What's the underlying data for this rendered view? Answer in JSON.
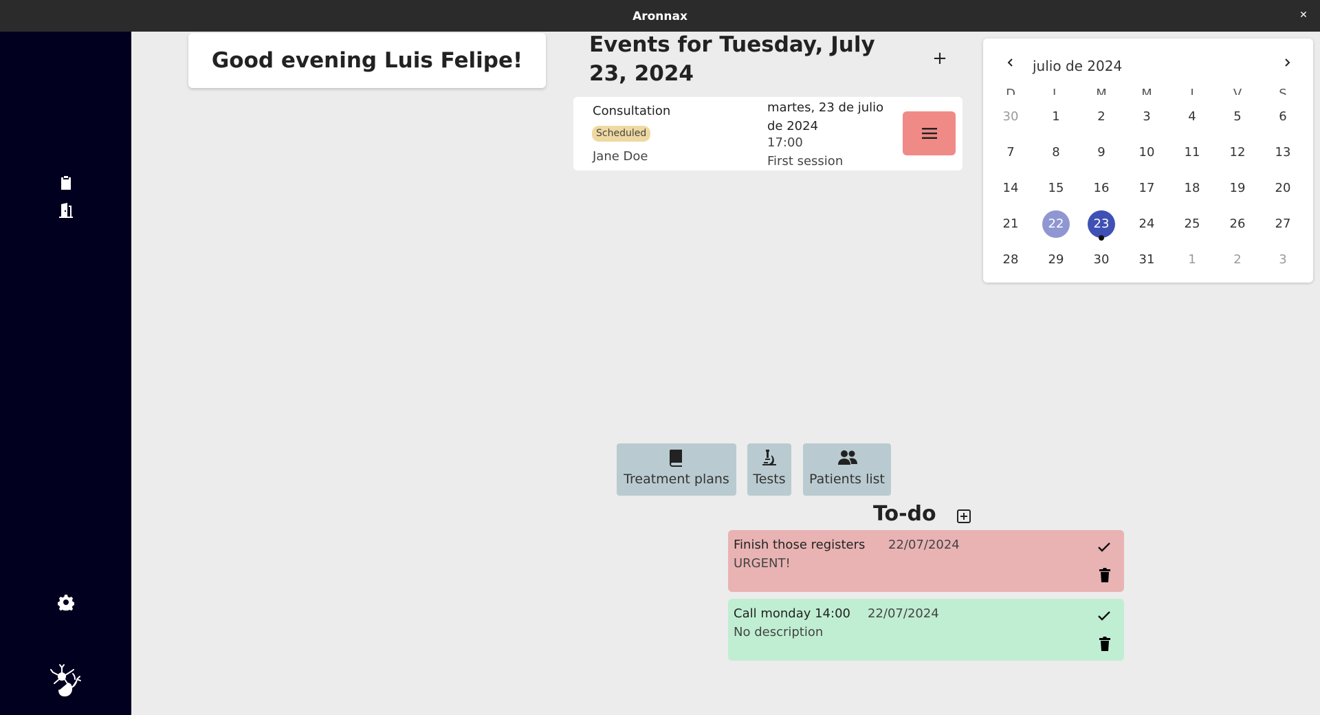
{
  "window": {
    "title": "Aronnax",
    "close_icon": "close-icon"
  },
  "sidebar": {
    "icons": [
      "clipboard-badge-icon",
      "door-exit-icon",
      "gear-icon",
      "app-logo"
    ]
  },
  "greeting": {
    "text": "Good evening Luis Felipe!"
  },
  "events": {
    "title": "Events for Tuesday, July 23, 2024",
    "add_label": "+",
    "items": [
      {
        "type": "Consultation",
        "status": "Scheduled",
        "status_color": "#efd9a1",
        "patient": "Jane Doe",
        "date": "martes, 23 de julio de 2024",
        "time": "17:00",
        "description": "First session",
        "menu_color": "#f08a87"
      }
    ]
  },
  "calendar": {
    "month_label": "julio de 2024",
    "weekdays": [
      "D",
      "L",
      "M",
      "M",
      "J",
      "V",
      "S"
    ],
    "weeks": [
      [
        "30",
        "1",
        "2",
        "3",
        "4",
        "5",
        "6"
      ],
      [
        "7",
        "8",
        "9",
        "10",
        "11",
        "12",
        "13"
      ],
      [
        "14",
        "15",
        "16",
        "17",
        "18",
        "19",
        "20"
      ],
      [
        "21",
        "22",
        "23",
        "24",
        "25",
        "26",
        "27"
      ],
      [
        "28",
        "29",
        "30",
        "31",
        "1",
        "2",
        "3"
      ]
    ],
    "today": "22",
    "selected": "23",
    "today_color": "#8f97d2",
    "selected_color": "#3f51b5"
  },
  "quick_actions": [
    {
      "label": "Treatment plans",
      "icon": "book-icon"
    },
    {
      "label": "Tests",
      "icon": "microscope-icon"
    },
    {
      "label": "Patients list",
      "icon": "users-icon"
    }
  ],
  "todo": {
    "title": "To-do",
    "add_icon": "add-square-icon",
    "items": [
      {
        "title": "Finish those registers",
        "date": "22/07/2024",
        "description": "URGENT!",
        "color": "#e9b3b3"
      },
      {
        "title": "Call monday 14:00",
        "date": "22/07/2024",
        "description": "No description",
        "color": "#c0eed2"
      }
    ]
  }
}
